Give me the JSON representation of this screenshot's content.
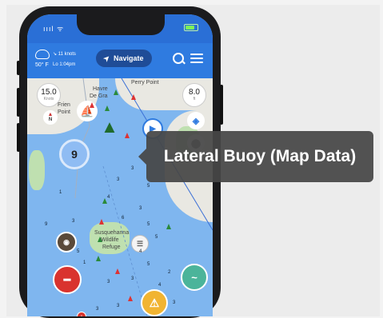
{
  "status_bar": {
    "signal_label": "ıııl ᯤ"
  },
  "top_bar": {
    "wind": "↘ 11 knots",
    "temperature": "50° F",
    "tide": "Lo 1:04pm",
    "navigate_label": "Navigate",
    "navigate_icon": "navigation-arrow-icon"
  },
  "map": {
    "wind_gauge": {
      "value": "15.0",
      "unit": "Knots"
    },
    "depth_gauge": {
      "value": "8.0",
      "unit": "ft"
    },
    "place_names": [
      "Havre",
      "De Gra",
      "Perry Point",
      "Frien",
      "Point",
      "Susquehanna",
      "Wildlife",
      "Refuge"
    ],
    "cluster_count": "9",
    "compass_label": "N",
    "depths": [
      "3",
      "3",
      "5",
      "4",
      "3",
      "6",
      "3",
      "5",
      "5",
      "9",
      "5",
      "4",
      "1",
      "5",
      "2",
      "3",
      "4",
      "1",
      "3",
      "3",
      "3",
      "3"
    ]
  },
  "tooltip": {
    "text": "Lateral Buoy (Map Data)"
  },
  "colors": {
    "ocean": "#7fb6ef",
    "topbar": "#2f7be0",
    "navigate": "#1f4c97",
    "tooltip": "#464646",
    "no_entry": "#d9332e",
    "warning": "#f1b431",
    "dolphin": "#4bb49a"
  }
}
